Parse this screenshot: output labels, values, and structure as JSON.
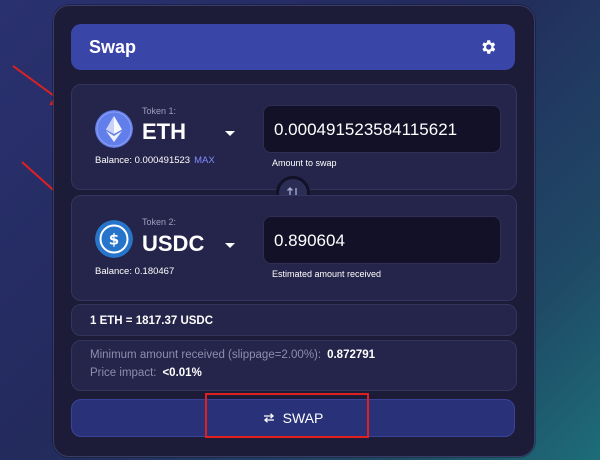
{
  "header": {
    "title": "Swap",
    "icon": "gear-icon"
  },
  "from": {
    "caption": "Token 1:",
    "symbol": "ETH",
    "balance_label": "Balance: 0.000491523",
    "max_label": "MAX",
    "amount": "0.000491523584115621",
    "amount_caption": "Amount to swap",
    "icon": "eth-icon",
    "icon_color": "#627eea"
  },
  "to": {
    "caption": "Token 2:",
    "symbol": "USDC",
    "balance_label": "Balance: 0.180467",
    "amount": "0.890604",
    "amount_caption": "Estimated amount received",
    "icon": "usdc-icon",
    "icon_color": "#2775ca"
  },
  "rate": "1 ETH = 1817.37 USDC",
  "info": {
    "min_label": "Minimum amount received (slippage=2.00%):",
    "min_value": "0.872791",
    "impact_label": "Price impact:",
    "impact_value": "<0.01%"
  },
  "swap_button": {
    "label": "SWAP",
    "icon": "swap-arrows-icon"
  },
  "colors": {
    "annotation": "#e02020",
    "accent": "#3a45a8"
  }
}
